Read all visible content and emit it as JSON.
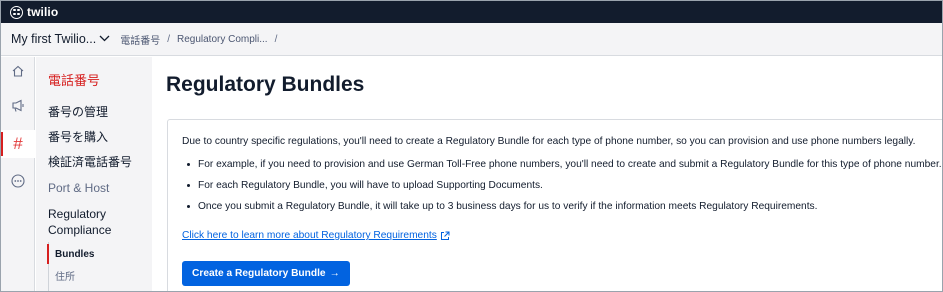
{
  "brand": {
    "name": "twilio"
  },
  "account": {
    "name": "My first Twilio...",
    "chevron": "⌵"
  },
  "breadcrumbs": [
    {
      "label": "電話番号"
    },
    {
      "label": "Regulatory Compli..."
    },
    {
      "label": ""
    }
  ],
  "breadcrumb_separator": "/",
  "rail": [
    {
      "icon": "home-icon"
    },
    {
      "icon": "megaphone-icon"
    },
    {
      "icon": "hash-icon",
      "glyph": "#",
      "active": true
    },
    {
      "icon": "more-icon"
    }
  ],
  "nav": {
    "title": "電話番号",
    "items": [
      {
        "label": "番号の管理"
      },
      {
        "label": "番号を購入"
      },
      {
        "label": "検証済電話番号"
      },
      {
        "label": "Port & Host"
      },
      {
        "label": "Regulatory Compliance"
      }
    ],
    "subitems": [
      {
        "label": "Bundles",
        "active": true
      },
      {
        "label": "住所"
      }
    ]
  },
  "main": {
    "title": "Regulatory Bundles",
    "intro": "Due to country specific regulations, you'll need to create a Regulatory Bundle for each type of phone number, so you can provision and use phone numbers legally.",
    "bullets": [
      "For example, if you need to provision and use German Toll-Free phone numbers, you'll need to create and submit a Regulatory Bundle for this type of phone number.",
      "For each Regulatory Bundle, you will have to upload Supporting Documents.",
      "Once you submit a Regulatory Bundle, it will take up to 3 business days for us to verify if the information meets Regulatory Requirements."
    ],
    "learn_more": "Click here to learn more about Regulatory Requirements",
    "cta": "Create a Regulatory Bundle",
    "cta_arrow": "→"
  },
  "colors": {
    "topbar": "#121c2d",
    "accent_red": "#d61f1f",
    "link_blue": "#0263e0",
    "sidebar_bg": "#f4f4f6"
  }
}
